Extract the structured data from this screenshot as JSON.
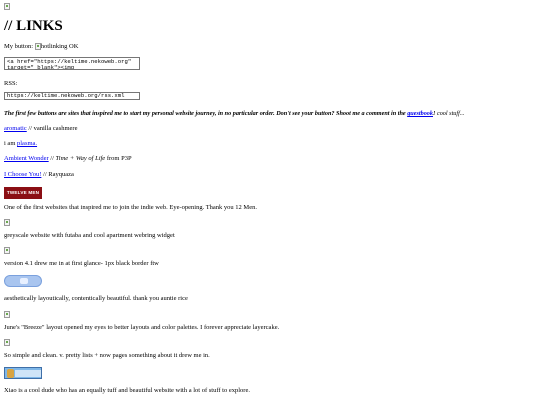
{
  "heading": "// LINKS",
  "my_button": {
    "label": "My button:",
    "alt_text": "hotlinking OK",
    "code": "<a href=\"https://keltime.nekoweb.org\" target=\"_blank\"><img"
  },
  "rss": {
    "label": "RSS:",
    "value": "https://keltime.nekoweb.org/rss.xml"
  },
  "intro": {
    "bold_before": "The first few buttons are sites that inspired me to start my personal website journey, in no particular order. Don't see your button? Shoot me a comment in the ",
    "link": "guestbook",
    "bold_after": "!",
    "tail": " cool stuff..."
  },
  "links": [
    {
      "link": "aromatic",
      "rest": " // vanilla cashmere"
    },
    {
      "pre": "i am ",
      "link": "plasma."
    },
    {
      "link": "Ambient Wonder",
      "rest": " // ",
      "italic": "Time + Way of Life",
      "rest2": " from P3P"
    },
    {
      "link": "I Choose You!",
      "rest": " // Rayquaza"
    }
  ],
  "buttons": [
    {
      "badge": "TWELVE MEN",
      "desc": "One of the first websites that inspired me to join the indie web. Eye-opening. Thank you 12 Men."
    },
    {
      "desc": "greyscale website with futaba and cool apartment webring widget"
    },
    {
      "desc": "version 4.1 drew me in at first glance- 1px black border ftw"
    },
    {
      "desc": "aesthetically layoutically, contentically beautiful. thank you auntie rice"
    },
    {
      "desc": "June's \"Breeze\" layout opened my eyes to better layouts and color palettes. I forever appreciate layercake."
    },
    {
      "desc": "So simple and clean. v. pretty lists + now pages something about it drew me in."
    },
    {
      "desc": "Xiao is a cool dude who has an equally tuff and beautiful website with a lot of stuff to explore."
    }
  ],
  "colors": {
    "link": "#0000ee",
    "twelve_men_bg": "#8b0f14",
    "cloud_button": "#a9c5ef",
    "xiao_button": "#7fb7e8"
  }
}
